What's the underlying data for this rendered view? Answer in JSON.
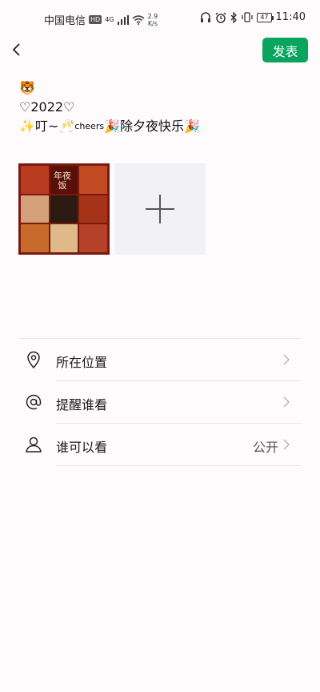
{
  "status_bar": {
    "carrier": "中国电信",
    "hd_badge": "HD",
    "signal_label": "4G",
    "speed_value": "2.9",
    "speed_unit": "K/s",
    "battery": "47",
    "time": "11:40"
  },
  "nav": {
    "publish_label": "发表"
  },
  "post": {
    "line1": "🐯",
    "line2": "♡2022♡",
    "line3_a": "✨叮~🥂",
    "line3_sup": "cheers",
    "line3_b": "🎉除夕夜快乐🎉"
  },
  "photo": {
    "caption": "年夜饭"
  },
  "options": [
    {
      "icon": "location-pin-icon",
      "label": "所在位置",
      "value": ""
    },
    {
      "icon": "at-sign-icon",
      "label": "提醒谁看",
      "value": ""
    },
    {
      "icon": "person-icon",
      "label": "谁可以看",
      "value": "公开"
    }
  ],
  "colors": {
    "accent": "#09a55e",
    "background": "#fefbfd",
    "photo_frame": "#7a1a0f"
  }
}
